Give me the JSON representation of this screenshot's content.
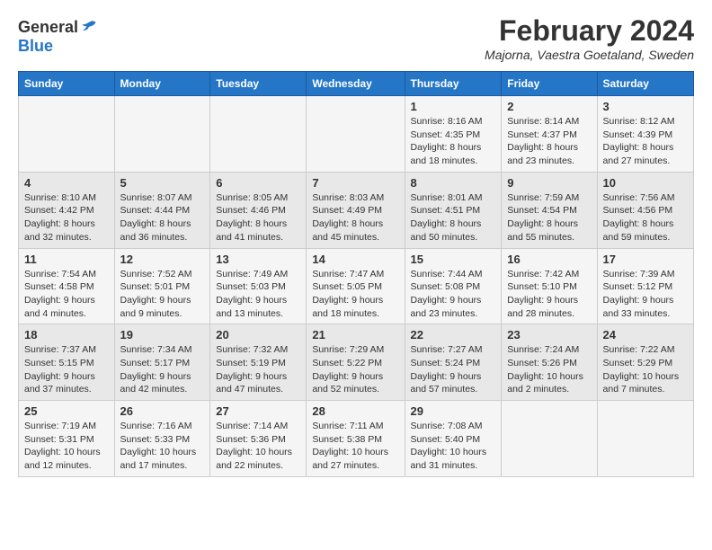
{
  "logo": {
    "general": "General",
    "blue": "Blue"
  },
  "title": {
    "month_year": "February 2024",
    "location": "Majorna, Vaestra Goetaland, Sweden"
  },
  "headers": [
    "Sunday",
    "Monday",
    "Tuesday",
    "Wednesday",
    "Thursday",
    "Friday",
    "Saturday"
  ],
  "weeks": [
    [
      {
        "day": "",
        "detail": ""
      },
      {
        "day": "",
        "detail": ""
      },
      {
        "day": "",
        "detail": ""
      },
      {
        "day": "",
        "detail": ""
      },
      {
        "day": "1",
        "detail": "Sunrise: 8:16 AM\nSunset: 4:35 PM\nDaylight: 8 hours and 18 minutes."
      },
      {
        "day": "2",
        "detail": "Sunrise: 8:14 AM\nSunset: 4:37 PM\nDaylight: 8 hours and 23 minutes."
      },
      {
        "day": "3",
        "detail": "Sunrise: 8:12 AM\nSunset: 4:39 PM\nDaylight: 8 hours and 27 minutes."
      }
    ],
    [
      {
        "day": "4",
        "detail": "Sunrise: 8:10 AM\nSunset: 4:42 PM\nDaylight: 8 hours and 32 minutes."
      },
      {
        "day": "5",
        "detail": "Sunrise: 8:07 AM\nSunset: 4:44 PM\nDaylight: 8 hours and 36 minutes."
      },
      {
        "day": "6",
        "detail": "Sunrise: 8:05 AM\nSunset: 4:46 PM\nDaylight: 8 hours and 41 minutes."
      },
      {
        "day": "7",
        "detail": "Sunrise: 8:03 AM\nSunset: 4:49 PM\nDaylight: 8 hours and 45 minutes."
      },
      {
        "day": "8",
        "detail": "Sunrise: 8:01 AM\nSunset: 4:51 PM\nDaylight: 8 hours and 50 minutes."
      },
      {
        "day": "9",
        "detail": "Sunrise: 7:59 AM\nSunset: 4:54 PM\nDaylight: 8 hours and 55 minutes."
      },
      {
        "day": "10",
        "detail": "Sunrise: 7:56 AM\nSunset: 4:56 PM\nDaylight: 8 hours and 59 minutes."
      }
    ],
    [
      {
        "day": "11",
        "detail": "Sunrise: 7:54 AM\nSunset: 4:58 PM\nDaylight: 9 hours and 4 minutes."
      },
      {
        "day": "12",
        "detail": "Sunrise: 7:52 AM\nSunset: 5:01 PM\nDaylight: 9 hours and 9 minutes."
      },
      {
        "day": "13",
        "detail": "Sunrise: 7:49 AM\nSunset: 5:03 PM\nDaylight: 9 hours and 13 minutes."
      },
      {
        "day": "14",
        "detail": "Sunrise: 7:47 AM\nSunset: 5:05 PM\nDaylight: 9 hours and 18 minutes."
      },
      {
        "day": "15",
        "detail": "Sunrise: 7:44 AM\nSunset: 5:08 PM\nDaylight: 9 hours and 23 minutes."
      },
      {
        "day": "16",
        "detail": "Sunrise: 7:42 AM\nSunset: 5:10 PM\nDaylight: 9 hours and 28 minutes."
      },
      {
        "day": "17",
        "detail": "Sunrise: 7:39 AM\nSunset: 5:12 PM\nDaylight: 9 hours and 33 minutes."
      }
    ],
    [
      {
        "day": "18",
        "detail": "Sunrise: 7:37 AM\nSunset: 5:15 PM\nDaylight: 9 hours and 37 minutes."
      },
      {
        "day": "19",
        "detail": "Sunrise: 7:34 AM\nSunset: 5:17 PM\nDaylight: 9 hours and 42 minutes."
      },
      {
        "day": "20",
        "detail": "Sunrise: 7:32 AM\nSunset: 5:19 PM\nDaylight: 9 hours and 47 minutes."
      },
      {
        "day": "21",
        "detail": "Sunrise: 7:29 AM\nSunset: 5:22 PM\nDaylight: 9 hours and 52 minutes."
      },
      {
        "day": "22",
        "detail": "Sunrise: 7:27 AM\nSunset: 5:24 PM\nDaylight: 9 hours and 57 minutes."
      },
      {
        "day": "23",
        "detail": "Sunrise: 7:24 AM\nSunset: 5:26 PM\nDaylight: 10 hours and 2 minutes."
      },
      {
        "day": "24",
        "detail": "Sunrise: 7:22 AM\nSunset: 5:29 PM\nDaylight: 10 hours and 7 minutes."
      }
    ],
    [
      {
        "day": "25",
        "detail": "Sunrise: 7:19 AM\nSunset: 5:31 PM\nDaylight: 10 hours and 12 minutes."
      },
      {
        "day": "26",
        "detail": "Sunrise: 7:16 AM\nSunset: 5:33 PM\nDaylight: 10 hours and 17 minutes."
      },
      {
        "day": "27",
        "detail": "Sunrise: 7:14 AM\nSunset: 5:36 PM\nDaylight: 10 hours and 22 minutes."
      },
      {
        "day": "28",
        "detail": "Sunrise: 7:11 AM\nSunset: 5:38 PM\nDaylight: 10 hours and 27 minutes."
      },
      {
        "day": "29",
        "detail": "Sunrise: 7:08 AM\nSunset: 5:40 PM\nDaylight: 10 hours and 31 minutes."
      },
      {
        "day": "",
        "detail": ""
      },
      {
        "day": "",
        "detail": ""
      }
    ]
  ]
}
